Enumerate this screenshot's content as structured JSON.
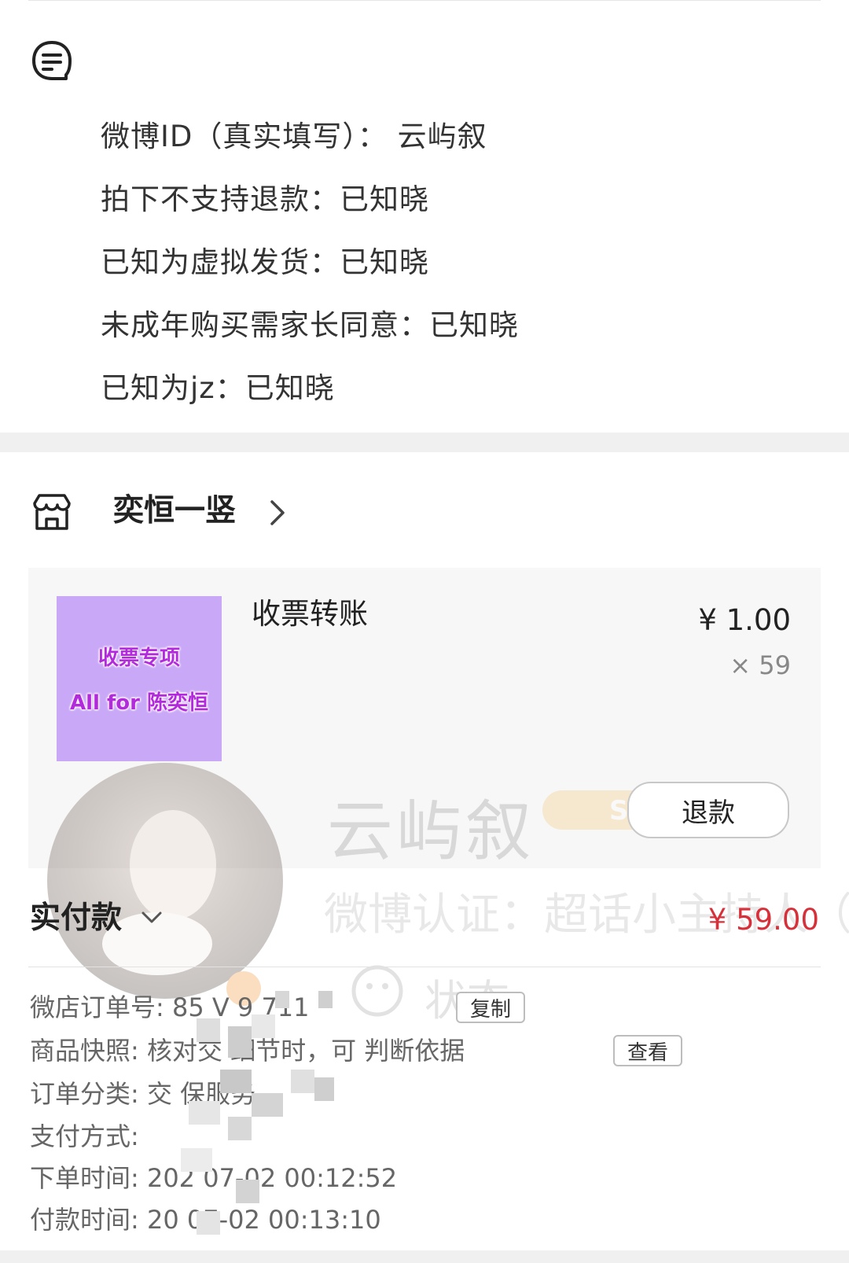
{
  "remarks": [
    "微博ID（真实填写）： 云屿叙",
    "拍下不支持退款：已知晓",
    "已知为虚拟发货：已知晓",
    "未成年购买需家长同意：已知晓",
    "已知为jz：已知晓"
  ],
  "store": {
    "name": "奕恒一竖"
  },
  "product": {
    "thumb_line1": "收票专项",
    "thumb_line2": "All for 陈奕恒",
    "title": "收票转账",
    "price": "¥ 1.00",
    "quantity": "× 59",
    "refund_button": "退款"
  },
  "overlay": {
    "name": "云屿叙",
    "cert": "微博认证：超话小主持人（",
    "status": "状态"
  },
  "payment": {
    "label": "实付款",
    "amount": "¥ 59.00"
  },
  "details": {
    "order_no": "微店订单号: 85 V  9  711",
    "copy_button": "复制",
    "snapshot": "商品快照: 核对交  细节时，可   判断依据",
    "view_button": "查看",
    "category": "订单分类: 交         保服务",
    "pay_method": "支付方式: ",
    "order_time": "下单时间:  202   07-02 00:12:52",
    "pay_time": "付款时间:  20      07-02 00:13:10"
  },
  "colors": {
    "accent_red": "#d6303a",
    "thumb_bg": "#c9a8f7",
    "thumb_text": "#b22adb"
  }
}
